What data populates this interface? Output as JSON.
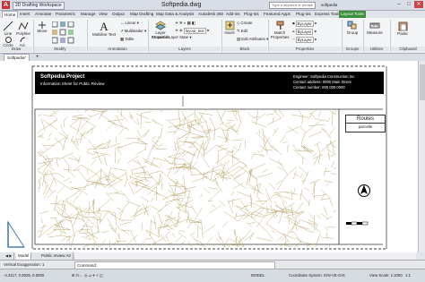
{
  "titlebar": {
    "app_letter": "A",
    "workspace": "2D Drafting Workspace",
    "document": "Softpedia.dwg",
    "search_placeholder": "Type a keyword or phrase",
    "user": "softpedia",
    "min": "–",
    "max": "□",
    "close": "✕"
  },
  "tabs": [
    "Home",
    "Insert",
    "Annotate",
    "Parametric",
    "Manage",
    "View",
    "Output",
    "Map Drafting",
    "Map Data & Analysis",
    "Autodesk 360",
    "Add-ins",
    "Plug-ins",
    "Featured Apps",
    "Plug-ins",
    "Express Tools",
    "Layout Tools"
  ],
  "ribbon": {
    "draw": {
      "line": "Line",
      "polyline": "Polyline",
      "circle": "Circle",
      "arc": "Arc",
      "label": "Draw"
    },
    "modify": {
      "move": "Move",
      "label": "Modify"
    },
    "annotation": {
      "text": "Multiline Text",
      "linear": "Linear",
      "multileader": "Multileader",
      "table": "Table",
      "label": "Annotation"
    },
    "layers": {
      "properties": "Layer Properties",
      "unsaved": "Unsaved Layer State",
      "layout": "layout_text",
      "label": "Layers"
    },
    "block": {
      "insert": "Insert",
      "create": "Create",
      "edit": "Edit",
      "edit_attr": "Edit Attributes",
      "label": "Block"
    },
    "properties": {
      "match": "Match Properties",
      "bylayer1": "ByLayer",
      "bylayer2": "ByLayer",
      "bylayer3": "ByLayer",
      "label": "Properties"
    },
    "groups": {
      "group": "Group",
      "label": "Groups"
    },
    "utilities": {
      "measure": "Measure",
      "label": "Utilities"
    },
    "clipboard": {
      "paste": "Paste",
      "label": "Clipboard"
    }
  },
  "filetab": "Softpedia*",
  "drawing": {
    "project": "Softpedia Project",
    "subtitle": "Information Sheet for Public Review",
    "engineer": "Engineer: Softpedia Construction Inc.",
    "contact_address": "Contact address: 0000 Main Street",
    "contact_number": "Contact number: 000 000 0000",
    "routes": "Routes",
    "parcelle": "parcelle"
  },
  "layout_tabs": [
    "Model",
    "Public review A0"
  ],
  "command": {
    "label": "Command:",
    "vertical_exag": "Vertical Exaggeration: 1"
  },
  "status": {
    "coords": "-4.3117, 0.9025, 0.0000",
    "model": "MODEL",
    "coord_system": "Coordinate System: IGN-VE-GIS",
    "view_scale": "View Scale: 1:1000",
    "annotation": "1:1"
  },
  "colors": {
    "map_lines": "#b8a36a",
    "accent": "#3b8f3b"
  }
}
